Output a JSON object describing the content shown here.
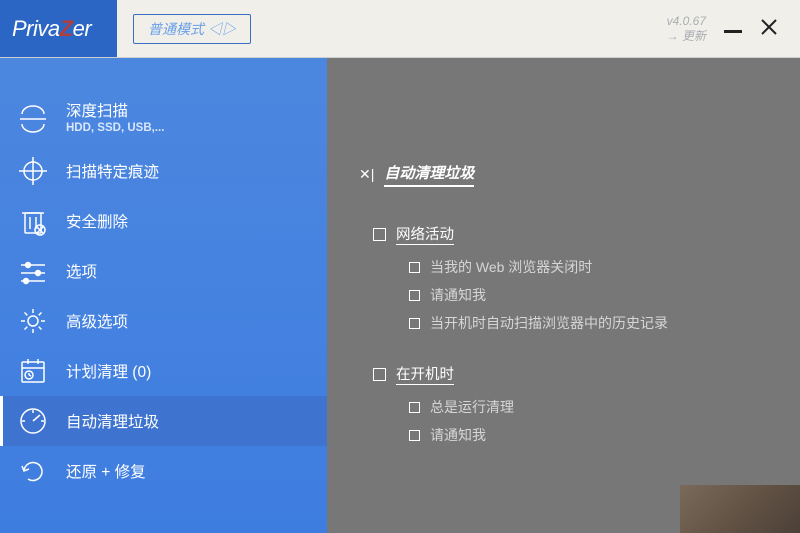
{
  "app": {
    "name_pre": "Priva",
    "name_z": "Z",
    "name_post": "er",
    "mode_label": "普通模式 ◁▷",
    "version": "v4.0.67",
    "update_label": "更新"
  },
  "sidebar": {
    "items": [
      {
        "label": "深度扫描",
        "sub": "HDD, SSD, USB,..."
      },
      {
        "label": "扫描特定痕迹"
      },
      {
        "label": "安全删除"
      },
      {
        "label": "选项"
      },
      {
        "label": "高级选项"
      },
      {
        "label": "计划清理 (0)"
      },
      {
        "label": "自动清理垃圾"
      },
      {
        "label": "还原 + 修复"
      }
    ]
  },
  "main": {
    "title": "自动清理垃圾",
    "sections": [
      {
        "title": "网络活动",
        "items": [
          "当我的 Web 浏览器关闭时",
          "请通知我",
          "当开机时自动扫描浏览器中的历史记录"
        ]
      },
      {
        "title": "在开机时",
        "items": [
          "总是运行清理",
          "请通知我"
        ]
      }
    ]
  }
}
